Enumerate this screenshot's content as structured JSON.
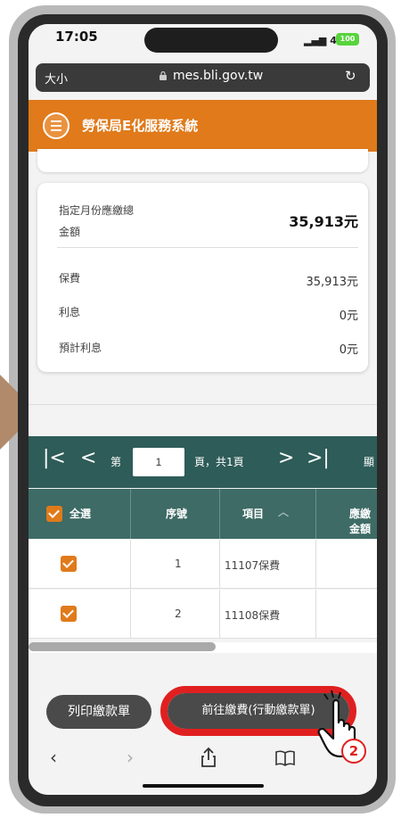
{
  "status_bar": {
    "time": "17:05",
    "network": "4G",
    "battery": "100"
  },
  "browser": {
    "text_size_label": "大小",
    "url": "mes.bli.gov.tw"
  },
  "app": {
    "title": "勞保局E化服務系統"
  },
  "summary": {
    "total_label_line1": "指定月份應繳總",
    "total_label_line2": "金額",
    "total_value": "35,913元",
    "rows": [
      {
        "label": "保費",
        "value": "35,913元"
      },
      {
        "label": "利息",
        "value": "0元"
      },
      {
        "label": "預計利息",
        "value": "0元"
      }
    ]
  },
  "pager": {
    "prefix": "第",
    "page": "1",
    "suffix": "頁，共1頁",
    "right_text": "顯"
  },
  "table": {
    "select_all": "全選",
    "headers": [
      "序號",
      "項目",
      "應繳金額"
    ],
    "rows": [
      {
        "seq": "1",
        "item": "11107保費"
      },
      {
        "seq": "2",
        "item": "11108保費"
      }
    ]
  },
  "actions": {
    "print_label": "列印繳款單",
    "pay_label": "前往繳費(行動繳款單)"
  },
  "annotation": {
    "step": "2"
  },
  "colors": {
    "brand_orange": "#e07a1a",
    "table_green": "#2e5c58",
    "highlight_red": "#e02020"
  }
}
